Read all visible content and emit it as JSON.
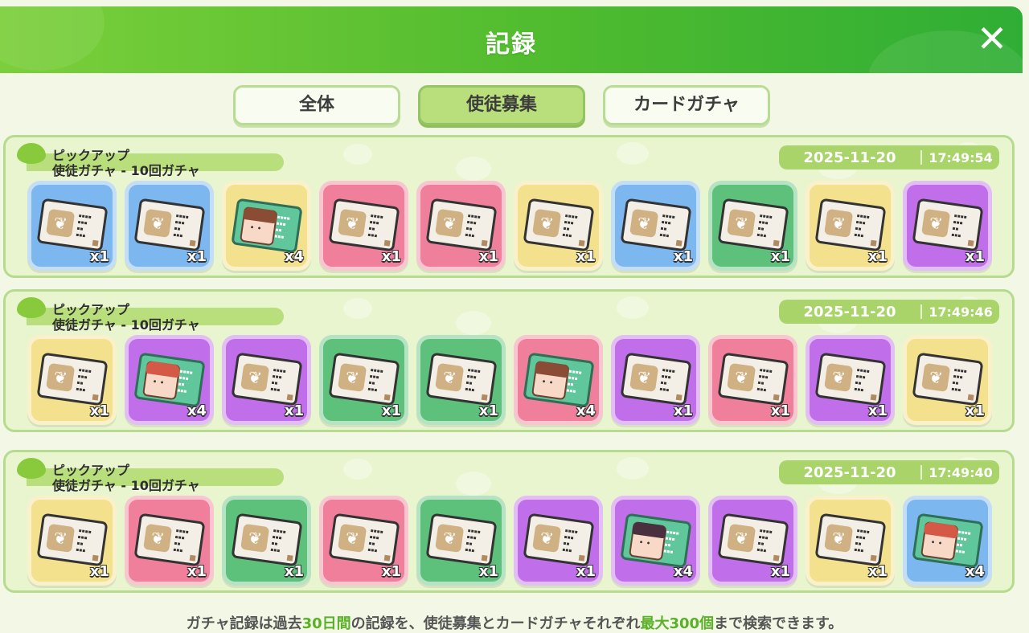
{
  "header": {
    "title": "記録",
    "close_icon": "close-icon"
  },
  "tabs": [
    {
      "label": "全体",
      "active": false
    },
    {
      "label": "使徒募集",
      "active": true
    },
    {
      "label": "カードガチャ",
      "active": false
    }
  ],
  "colors": {
    "header_start": "#7bcf3a",
    "header_end": "#2fae35",
    "accent": "#5ab128",
    "tab_active": "#b9df7c",
    "item_blue": "#7db7ef",
    "item_yellow": "#f3e18d",
    "item_pink": "#ef7f9a",
    "item_green": "#5dc17c",
    "item_purple": "#c06ee9"
  },
  "records": [
    {
      "title_line1": "ピックアップ",
      "title_line2": "使徒ガチャ - 10回ガチャ",
      "date": "2025-11-20",
      "time": "17:49:54",
      "items": [
        {
          "color": "blue",
          "kind": "ticket",
          "qty": "x1"
        },
        {
          "color": "blue",
          "kind": "ticket",
          "qty": "x1"
        },
        {
          "color": "yellow",
          "kind": "character",
          "hair": "brown",
          "qty": "x4"
        },
        {
          "color": "pink",
          "kind": "ticket",
          "qty": "x1"
        },
        {
          "color": "pink",
          "kind": "ticket",
          "qty": "x1"
        },
        {
          "color": "yellow",
          "kind": "ticket",
          "qty": "x1"
        },
        {
          "color": "blue",
          "kind": "ticket",
          "qty": "x1"
        },
        {
          "color": "green",
          "kind": "ticket",
          "qty": "x1"
        },
        {
          "color": "yellow",
          "kind": "ticket",
          "qty": "x1"
        },
        {
          "color": "purple",
          "kind": "ticket",
          "qty": "x1"
        }
      ]
    },
    {
      "title_line1": "ピックアップ",
      "title_line2": "使徒ガチャ - 10回ガチャ",
      "date": "2025-11-20",
      "time": "17:49:46",
      "items": [
        {
          "color": "yellow",
          "kind": "ticket",
          "qty": "x1"
        },
        {
          "color": "purple",
          "kind": "character",
          "hair": "red",
          "qty": "x4"
        },
        {
          "color": "purple",
          "kind": "ticket",
          "qty": "x1"
        },
        {
          "color": "green",
          "kind": "ticket",
          "qty": "x1"
        },
        {
          "color": "green",
          "kind": "ticket",
          "qty": "x1"
        },
        {
          "color": "pink",
          "kind": "character",
          "hair": "brown",
          "qty": "x4"
        },
        {
          "color": "purple",
          "kind": "ticket",
          "qty": "x1"
        },
        {
          "color": "pink",
          "kind": "ticket",
          "qty": "x1"
        },
        {
          "color": "purple",
          "kind": "ticket",
          "qty": "x1"
        },
        {
          "color": "yellow",
          "kind": "ticket",
          "qty": "x1"
        }
      ]
    },
    {
      "title_line1": "ピックアップ",
      "title_line2": "使徒ガチャ - 10回ガチャ",
      "date": "2025-11-20",
      "time": "17:49:40",
      "items": [
        {
          "color": "yellow",
          "kind": "ticket",
          "qty": "x1"
        },
        {
          "color": "pink",
          "kind": "ticket",
          "qty": "x1"
        },
        {
          "color": "green",
          "kind": "ticket",
          "qty": "x1"
        },
        {
          "color": "pink",
          "kind": "ticket",
          "qty": "x1"
        },
        {
          "color": "green",
          "kind": "ticket",
          "qty": "x1"
        },
        {
          "color": "purple",
          "kind": "ticket",
          "qty": "x1"
        },
        {
          "color": "purple",
          "kind": "character",
          "hair": "dark",
          "qty": "x4"
        },
        {
          "color": "purple",
          "kind": "ticket",
          "qty": "x1"
        },
        {
          "color": "yellow",
          "kind": "ticket",
          "qty": "x1"
        },
        {
          "color": "blue",
          "kind": "character",
          "hair": "red",
          "qty": "x4"
        }
      ]
    }
  ],
  "footer": {
    "part1": "ガチャ記録は過去",
    "highlight1": "30日間",
    "part2": "の記録を、使徒募集とカードガチャそれぞれ",
    "highlight2": "最大300個",
    "part3": "まで検索できます。"
  }
}
